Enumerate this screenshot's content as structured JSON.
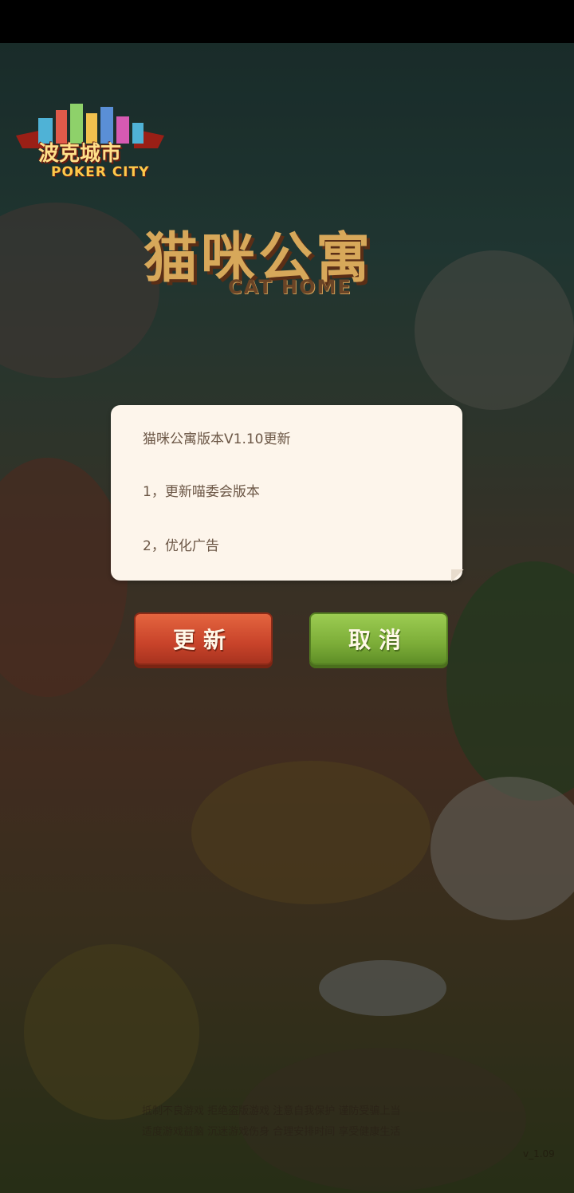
{
  "branding": {
    "publisher_logo_title": "波克城市",
    "publisher_logo_sub": "POKER CITY",
    "game_title": "猫咪公寓",
    "game_title_sub": "CAT HOME"
  },
  "update_dialog": {
    "title": "猫咪公寓版本V1.10更新",
    "items": [
      "1，更新喵委会版本",
      "2，优化广告"
    ]
  },
  "buttons": {
    "update_label": "更新",
    "cancel_label": "取消"
  },
  "footer": {
    "notice_line1": "抵制不良游戏 拒绝盗版游戏 注意自我保护 谨防受骗上当",
    "notice_line2": "适度游戏益脑 沉迷游戏伤身 合理安排时间 享受健康生活",
    "version": "v_1.09"
  },
  "colors": {
    "dialog_bg": "#fdf5eb",
    "update_button": "#d5502f",
    "cancel_button": "#86b73f"
  },
  "icons": [
    "city-skyline-logo-icon",
    "cat-paw-icon"
  ]
}
